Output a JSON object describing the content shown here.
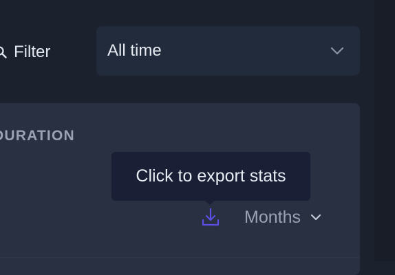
{
  "filter": {
    "label": "Filter",
    "icon": "search-icon"
  },
  "time_select": {
    "value": "All time",
    "icon": "chevron-down-icon"
  },
  "card": {
    "title": "DURATION"
  },
  "tooltip": {
    "text": "Click to export stats"
  },
  "export": {
    "icon": "download-icon",
    "color": "#5b4fe6"
  },
  "period_select": {
    "value": "Months",
    "icon": "chevron-down-icon"
  }
}
